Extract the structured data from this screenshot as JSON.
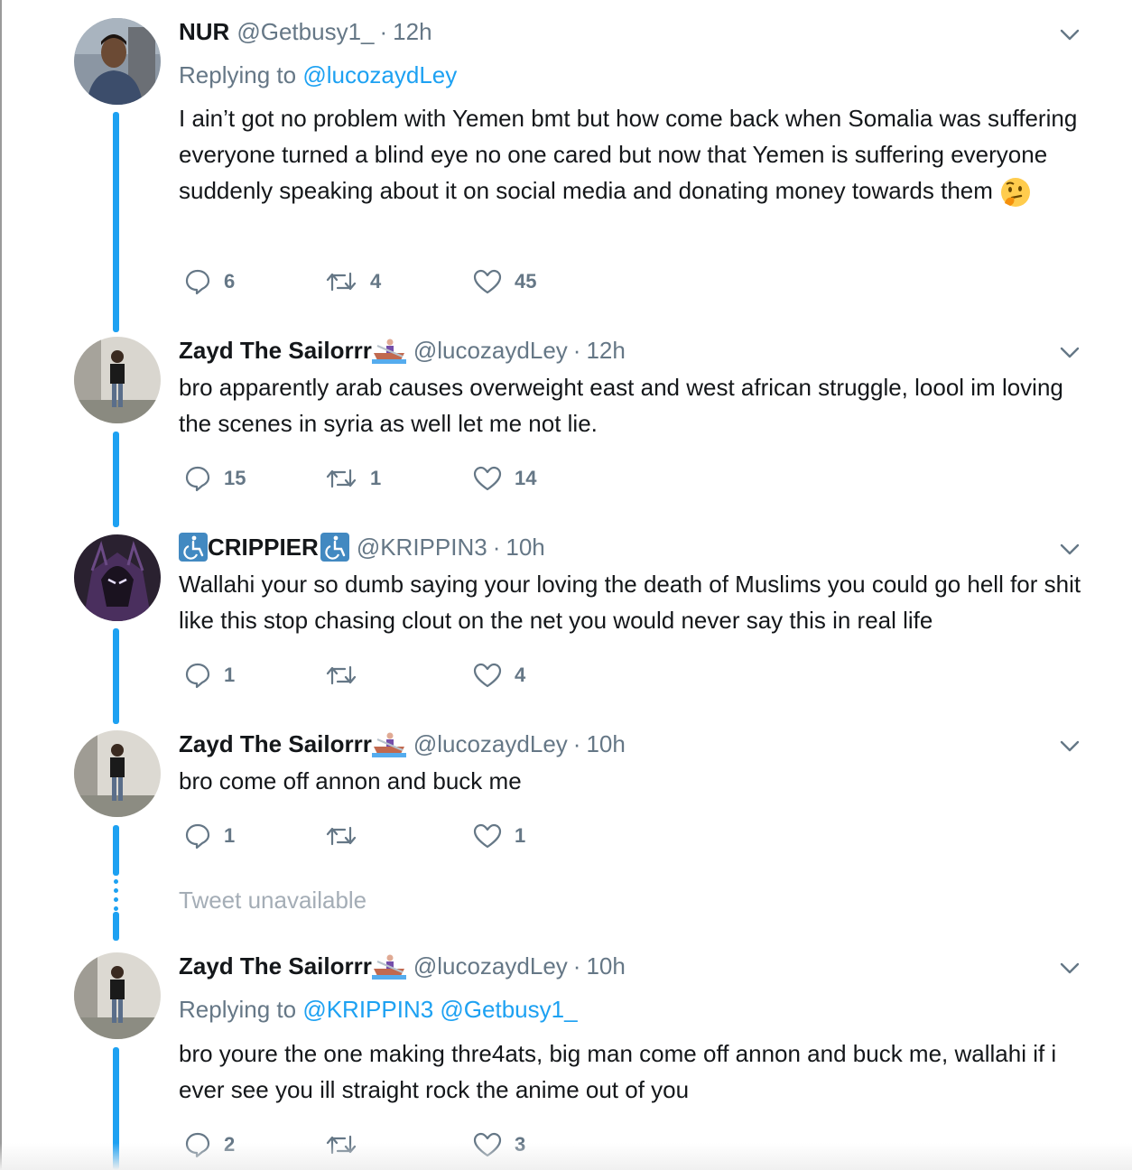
{
  "tweets": [
    {
      "name": "NUR",
      "handle": "@Getbusy1_",
      "time": "12h",
      "replying_label": "Replying to",
      "replying_to": "@lucozaydLey",
      "text": "I ain’t got no problem with Yemen bmt but how come back when Somalia was suffering everyone turned a blind eye no one cared but now that Yemen is suffering everyone suddenly speaking about it on social media and donating money towards them",
      "text_emoji": "thinking-face",
      "replies": "6",
      "retweets": "4",
      "likes": "45"
    },
    {
      "name": "Zayd The Sailorrr",
      "name_emoji": "rowboat",
      "handle": "@lucozaydLey",
      "time": "12h",
      "text": "bro apparently arab causes overweight east and west african struggle, loool im loving the scenes in syria as well let me not lie.",
      "replies": "15",
      "retweets": "1",
      "likes": "14"
    },
    {
      "name": "CRIPPIER",
      "name_emoji": "wheelchair",
      "handle": "@KRIPPIN3",
      "time": "10h",
      "text": "Wallahi your so dumb saying your loving the death of Muslims you could go hell for shit like this stop chasing clout on the net you would never say this in real life",
      "replies": "1",
      "retweets": "",
      "likes": "4"
    },
    {
      "name": "Zayd The Sailorrr",
      "name_emoji": "rowboat",
      "handle": "@lucozaydLey",
      "time": "10h",
      "text": "bro come off annon and buck me",
      "replies": "1",
      "retweets": "",
      "likes": "1"
    },
    {
      "name": "Zayd The Sailorrr",
      "name_emoji": "rowboat",
      "handle": "@lucozaydLey",
      "time": "10h",
      "replying_label": "Replying to",
      "replying_to": "@KRIPPIN3 @Getbusy1_",
      "text": "bro youre the one making thre4ats, big man come off annon and buck me, wallahi if i ever see you ill straight rock the anime out of you",
      "replies": "2",
      "retweets": "",
      "likes": "3"
    }
  ],
  "tweet_unavailable": "Tweet unavailable",
  "colors": {
    "accent": "#1da1f2",
    "muted": "#657786",
    "text": "#14171a",
    "unavailable": "#a4adb6"
  },
  "icons": [
    "reply-icon",
    "retweet-icon",
    "like-icon",
    "chevron-down-icon",
    "thinking-face-icon",
    "rowboat-icon",
    "wheelchair-icon"
  ]
}
